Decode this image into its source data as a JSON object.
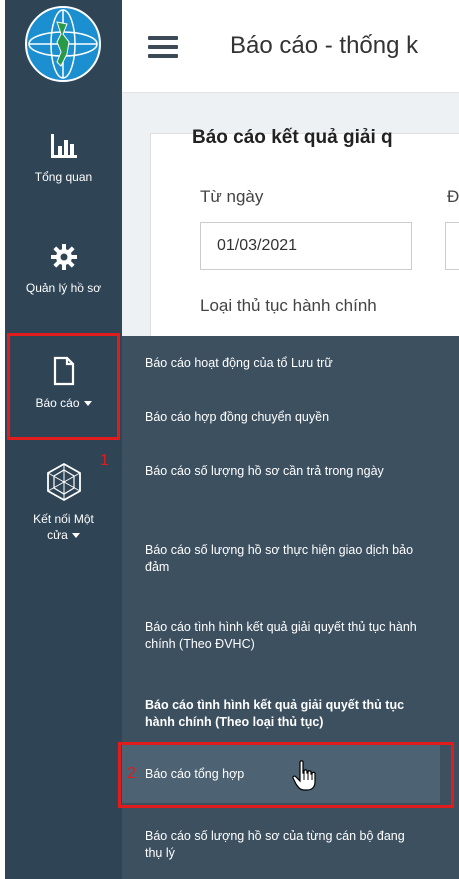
{
  "sidebar": {
    "items": [
      {
        "icon": "bar-chart-icon",
        "label": "Tổng quan"
      },
      {
        "icon": "gear-icon",
        "label": "Quản lý hồ sơ"
      },
      {
        "icon": "document-icon",
        "label": "Báo cáo"
      },
      {
        "icon": "network-icon",
        "label": "Kết nối Một cửa"
      }
    ]
  },
  "header": {
    "title": "Báo cáo - thống k"
  },
  "main": {
    "card_title": "Báo cáo kết quả giải q",
    "from_date_label": "Từ ngày",
    "to_date_label": "Đ",
    "from_date_value": "01/03/2021",
    "procedure_type_label": "Loại thủ tục hành chính"
  },
  "menu": {
    "items": [
      {
        "label": "Báo cáo hoạt động của tổ Lưu trữ"
      },
      {
        "label": "Báo cáo hợp đồng chuyển quyền"
      },
      {
        "label": "Báo cáo số lượng hồ sơ cần trả trong ngày"
      },
      {
        "label": "Báo cáo số lượng hồ sơ thực hiện giao dịch bảo đảm"
      },
      {
        "label": "Báo cáo tình hình kết quả giải quyết thủ tục hành chính (Theo ĐVHC)"
      },
      {
        "label": "Báo cáo tình hình kết quả giải quyết thủ tục hành chính (Theo loại thủ tục)"
      },
      {
        "label": "Báo cáo tổng hợp"
      },
      {
        "label": "Báo cáo số lượng hồ sơ của từng cán bộ đang thụ lý"
      }
    ]
  },
  "annotations": {
    "step1": "1",
    "step2": "2",
    "color": "#e01c1c"
  },
  "colors": {
    "sidebar": "#2f4556",
    "menu": "#3d5060",
    "menu_active": "#4d6272"
  }
}
